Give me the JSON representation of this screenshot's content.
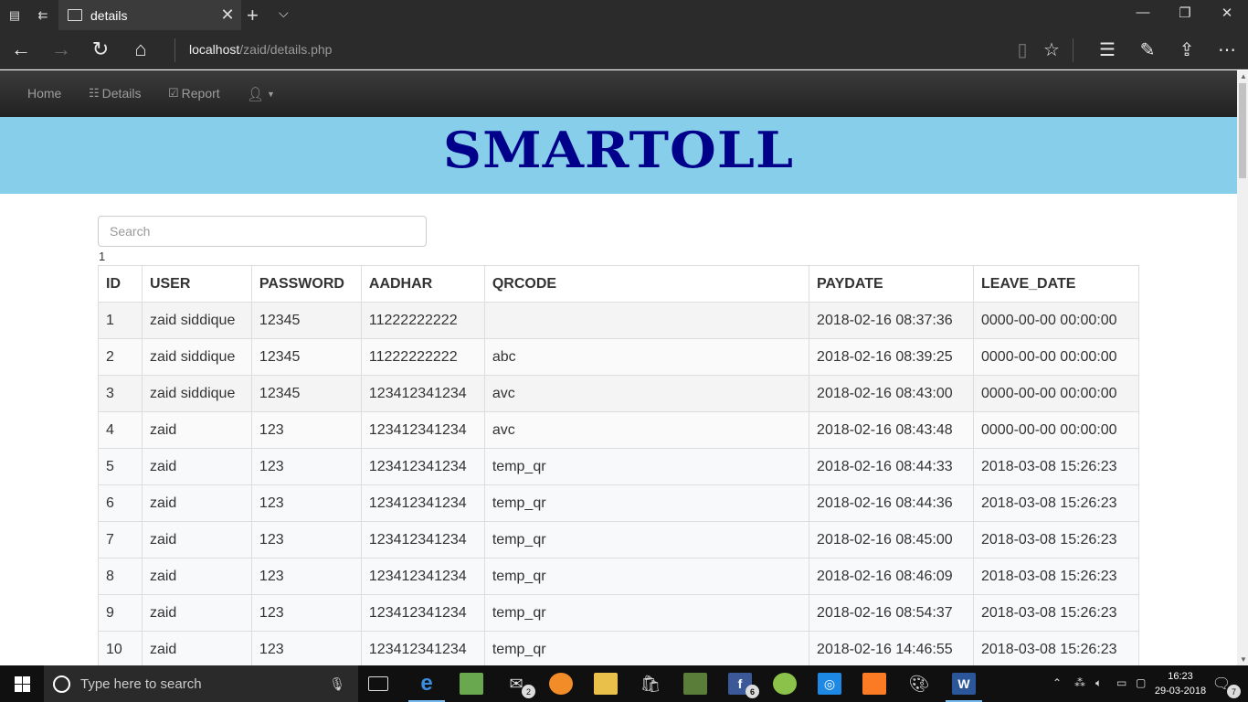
{
  "browser": {
    "tab_title": "details",
    "url_host": "localhost",
    "url_path": "/zaid/details.php"
  },
  "navbar": {
    "home": "Home",
    "details": "Details",
    "report": "Report"
  },
  "banner": {
    "title": "SMARTOLL",
    "bg_color": "#87ceeb",
    "title_color": "#00008b"
  },
  "search": {
    "placeholder": "Search",
    "value": ""
  },
  "page_count": "1",
  "table": {
    "headers": [
      "ID",
      "USER",
      "PASSWORD",
      "AADHAR",
      "QRCODE",
      "PAYDATE",
      "LEAVE_DATE"
    ],
    "rows": [
      [
        "1",
        "zaid siddique",
        "12345",
        "11222222222",
        "",
        "2018-02-16 08:37:36",
        "0000-00-00 00:00:00"
      ],
      [
        "2",
        "zaid siddique",
        "12345",
        "11222222222",
        "abc",
        "2018-02-16 08:39:25",
        "0000-00-00 00:00:00"
      ],
      [
        "3",
        "zaid siddique",
        "12345",
        "123412341234",
        "avc",
        "2018-02-16 08:43:00",
        "0000-00-00 00:00:00"
      ],
      [
        "4",
        "zaid",
        "123",
        "123412341234",
        "avc",
        "2018-02-16 08:43:48",
        "0000-00-00 00:00:00"
      ],
      [
        "5",
        "zaid",
        "123",
        "123412341234",
        "temp_qr",
        "2018-02-16 08:44:33",
        "2018-03-08 15:26:23"
      ],
      [
        "6",
        "zaid",
        "123",
        "123412341234",
        "temp_qr",
        "2018-02-16 08:44:36",
        "2018-03-08 15:26:23"
      ],
      [
        "7",
        "zaid",
        "123",
        "123412341234",
        "temp_qr",
        "2018-02-16 08:45:00",
        "2018-03-08 15:26:23"
      ],
      [
        "8",
        "zaid",
        "123",
        "123412341234",
        "temp_qr",
        "2018-02-16 08:46:09",
        "2018-03-08 15:26:23"
      ],
      [
        "9",
        "zaid",
        "123",
        "123412341234",
        "temp_qr",
        "2018-02-16 08:54:37",
        "2018-03-08 15:26:23"
      ],
      [
        "10",
        "zaid",
        "123",
        "123412341234",
        "temp_qr",
        "2018-02-16 14:46:55",
        "2018-03-08 15:26:23"
      ]
    ]
  },
  "taskbar": {
    "search_placeholder": "Type here to search",
    "mail_badge": "2",
    "facebook_badge": "6",
    "notification_badge": "7",
    "time": "16:23",
    "date": "29-03-2018"
  }
}
